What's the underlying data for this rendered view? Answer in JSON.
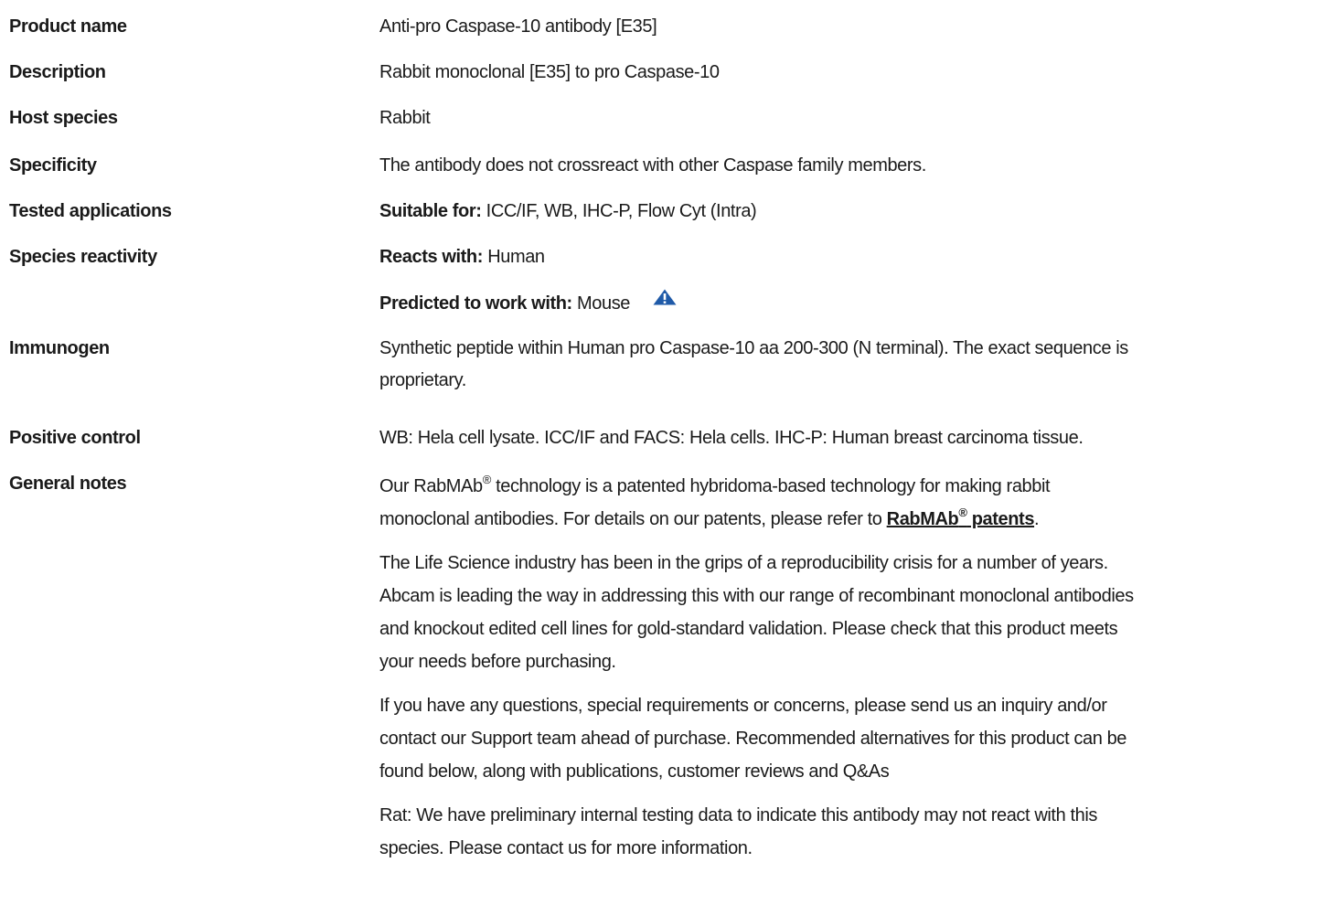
{
  "rows": {
    "product_name": {
      "label": "Product name",
      "value": "Anti-pro Caspase-10 antibody [E35]"
    },
    "description": {
      "label": "Description",
      "value": "Rabbit monoclonal [E35] to pro Caspase-10"
    },
    "host_species": {
      "label": "Host species",
      "value": "Rabbit"
    },
    "specificity": {
      "label": "Specificity",
      "value": "The antibody does not crossreact with other Caspase family members."
    },
    "tested_applications": {
      "label": "Tested applications",
      "prefix": "Suitable for:",
      "value": "ICC/IF, WB, IHC-P, Flow Cyt (Intra)"
    },
    "species_reactivity": {
      "label": "Species reactivity",
      "reacts_prefix": "Reacts with:",
      "reacts_value": "Human",
      "predicted_prefix": "Predicted to work with:",
      "predicted_value": "Mouse"
    },
    "immunogen": {
      "label": "Immunogen",
      "line1": "Synthetic peptide within Human pro Caspase-10 aa 200-300 (N terminal). The exact sequence is",
      "line2": "proprietary."
    },
    "positive_control": {
      "label": "Positive control",
      "value": "WB: Hela cell lysate. ICC/IF and FACS: Hela cells. IHC-P: Human breast carcinoma tissue."
    },
    "general_notes": {
      "label": "General notes",
      "p1_a": "Our RabMAb",
      "reg": "®",
      "p1_b": " technology is a patented hybridoma-based technology for making rabbit",
      "p1_c": "monoclonal antibodies. For details on our patents, please refer to ",
      "link_a": "RabMAb",
      "link_b": " patents",
      "p1_end": ".",
      "p2_l1": "The Life Science industry has been in the grips of a reproducibility crisis for a number of years.",
      "p2_l2": "Abcam is leading the way in addressing this with our range of recombinant monoclonal antibodies",
      "p2_l3": "and knockout edited cell lines for gold-standard validation. Please check that this product meets",
      "p2_l4": "your needs before purchasing.",
      "p3_l1": "If you have any questions, special requirements or concerns, please send us an inquiry and/or",
      "p3_l2": "contact our Support team ahead of purchase. Recommended alternatives for this product can be",
      "p3_l3": "found below, along with publications, customer reviews and Q&As",
      "p4_l1": "Rat: We have preliminary internal testing data to indicate this antibody may not react with this",
      "p4_l2": "species. Please contact us for more information."
    }
  },
  "colors": {
    "warning_icon": "#1f5aa8",
    "text": "#1a1a1a"
  },
  "icons": {
    "predicted": "warning-triangle-icon"
  }
}
